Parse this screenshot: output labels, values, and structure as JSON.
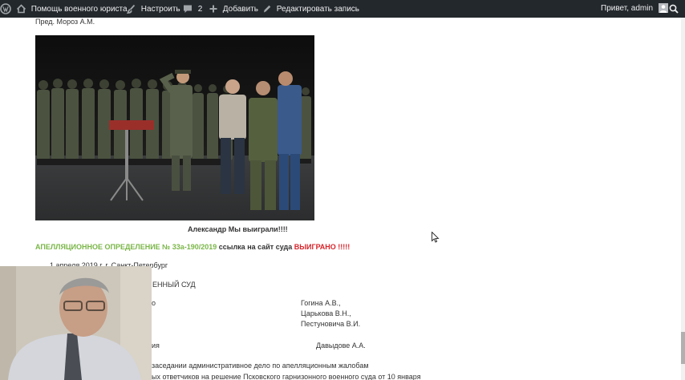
{
  "adminbar": {
    "site_name": "Помощь военного юриста",
    "customize": "Настроить",
    "comments_count": "2",
    "add_new": "Добавить",
    "edit_post": "Редактировать запись",
    "greeting": "Привет, admin",
    "colors": {
      "bar": "#23282d",
      "text": "#eeeeee",
      "icon": "#a0a5aa"
    }
  },
  "post": {
    "top_line": "Пред. Мороз А.М.",
    "photo_caption": "Александр Мы выиграли!!!!",
    "appeal": {
      "title": "АПЕЛЛЯЦИОННОЕ ОПРЕДЕЛЕНИЕ № 33а-190/2019",
      "link_text": " ссылка на сайт суда ",
      "won": "ВЫИГРАНО !!!!!",
      "colors": {
        "title": "#7ab648",
        "won": "#d6252b"
      }
    },
    "lines": {
      "date": "1 апреля 2019 г. г. Санкт-Петербург",
      "court": "ЕННЫЙ СУД",
      "l1_left": "о",
      "l1_right": "Гогина А.В.,",
      "l2_right": "Царькова В.Н.,",
      "l3_right": "Пестуновича В.И.",
      "l4_left": "ия",
      "l4_right": "Давыдове А.А.",
      "l5": "заседании административное дело по апелляционным жалобам",
      "l6": "ых ответчиков на решение Псковского гарнизонного военного суда от 10 января"
    }
  },
  "icons": {
    "wp": "wordpress-logo-icon",
    "home": "home-icon",
    "brush": "paintbrush-icon",
    "comment": "comment-bubble-icon",
    "plus": "plus-icon",
    "pencil": "pencil-icon",
    "avatar": "avatar-icon",
    "search": "search-icon",
    "cursor": "mouse-cursor-icon"
  }
}
